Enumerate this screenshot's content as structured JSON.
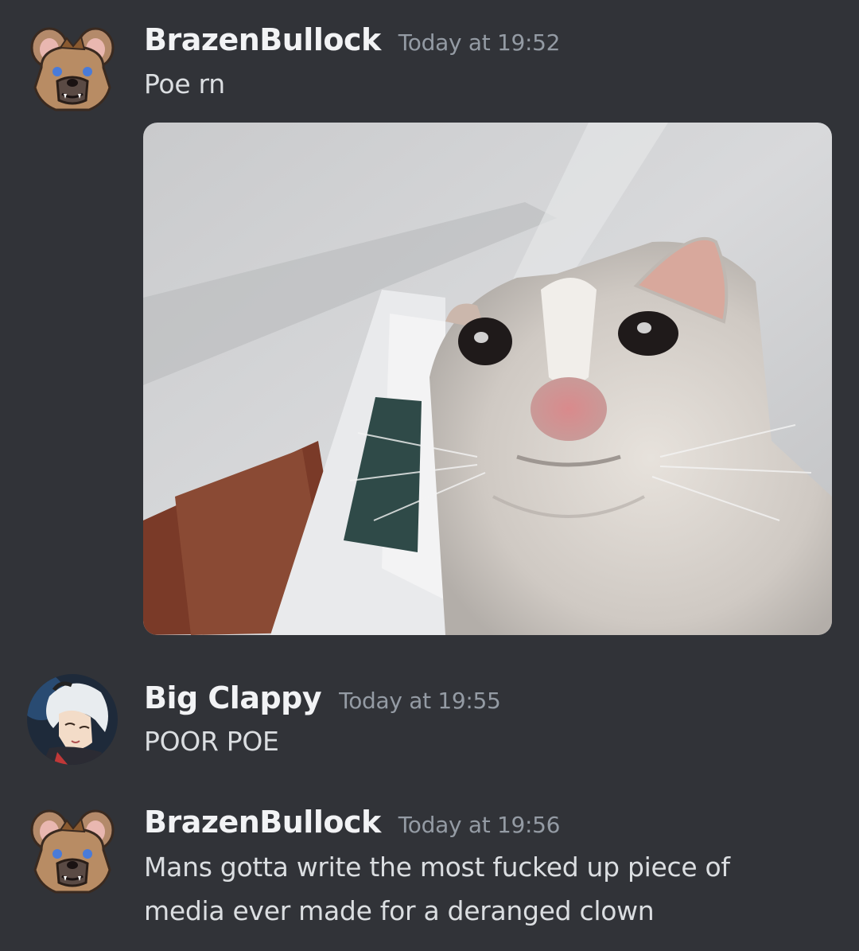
{
  "messages": [
    {
      "username": "BrazenBullock",
      "timestamp": "Today at 19:52",
      "text": "Poe rn",
      "avatar": "hyena-fursona-avatar",
      "attachment": "crying-cat-meme-image"
    },
    {
      "username": "Big Clappy",
      "timestamp": "Today at 19:55",
      "text": "POOR POE",
      "avatar": "anime-character-avatar"
    },
    {
      "username": "BrazenBullock",
      "timestamp": "Today at 19:56",
      "text": "Mans gotta write the most fucked up piece of media ever made for a deranged clown",
      "avatar": "hyena-fursona-avatar"
    }
  ],
  "colors": {
    "background": "#313338",
    "username": "#f2f3f5",
    "timestamp": "#949ba4",
    "message_text": "#dbdee1"
  }
}
